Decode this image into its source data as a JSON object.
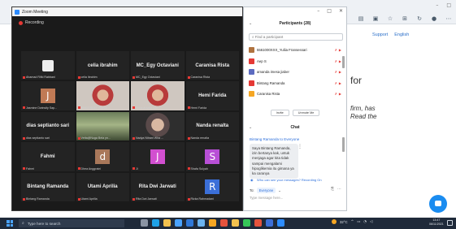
{
  "zoom": {
    "title": "Zoom Meeting",
    "recording": "Recording",
    "tiles": [
      {
        "name": "",
        "label": "Ahamad Rifki Rabbani",
        "avatar": "",
        "logo": true
      },
      {
        "name": "celia ibrahim",
        "label": "celia ibrahim",
        "avatar": ""
      },
      {
        "name": "MC_Egy Octaviani",
        "label": "MC_Egy Octaviani",
        "avatar": ""
      },
      {
        "name": "Caranisa Rista",
        "label": "Caranisa Rista",
        "avatar": ""
      },
      {
        "name": "",
        "label": "Jasmine Dwinsity Sap...",
        "avatar": "J",
        "avatar_color": "#c07a55"
      },
      {
        "name": "",
        "label": "5566293087_Salma ...",
        "video": "person"
      },
      {
        "name": "",
        "label": "Suna Amalia sari",
        "video": "person",
        "active": true
      },
      {
        "name": "Hemi Farida",
        "label": "Hemi Farida",
        "avatar": ""
      },
      {
        "name": "dias septianto sari",
        "label": "dias septianto sari",
        "avatar": ""
      },
      {
        "name": "",
        "label": "Vetta@Nuga Bela yn...",
        "video": "plant"
      },
      {
        "name": "",
        "label": "Nadya Nitrani Wira ...",
        "video": "person2"
      },
      {
        "name": "Nanda renalta",
        "label": "Nanda renalta",
        "avatar": ""
      },
      {
        "name": "Fahmi",
        "label": "Fahmi",
        "avatar": ""
      },
      {
        "name": "",
        "label": "Dhea Anggraini",
        "avatar": "d",
        "avatar_color": "#a9785a"
      },
      {
        "name": "",
        "label": "Ji",
        "avatar": "J",
        "avatar_color": "#d24fd0"
      },
      {
        "name": "",
        "label": "Shafa Sulyah",
        "avatar": "S",
        "avatar_color": "#b84fd6"
      },
      {
        "name": "Bintang Ramanda",
        "label": "Bintang Ramanda",
        "avatar": ""
      },
      {
        "name": "Utami Aprilia",
        "label": "Utami Aprilia",
        "avatar": ""
      },
      {
        "name": "Rita Dwi Jarwati",
        "label": "Rita Dwi Jarwati",
        "avatar": ""
      },
      {
        "name": "",
        "label": "Rizka Rahmadani",
        "avatar": "R",
        "avatar_color": "#3b6fd8"
      }
    ]
  },
  "participants": {
    "title": "Participants (28)",
    "search_placeholder": "Find a participant",
    "list": [
      {
        "name": "5561000XXX_Yuliia Fransessari",
        "color": "#b0733f"
      },
      {
        "name": "Aep S",
        "color": "#e53935"
      },
      {
        "name": "amanda imesa jiaber",
        "color": "#5c6bc0"
      },
      {
        "name": "Bintang Ramanda",
        "color": "#e53935"
      },
      {
        "name": "Caranisa Rista",
        "color": "#f5a623"
      }
    ],
    "invite_label": "Invite",
    "unmute_label": "Unmute Me"
  },
  "chat": {
    "title": "Chat",
    "sender": "Bintang Ramanda to Everyone",
    "message": "Saya Bintang Ramanda, izin bertanya kak, untuk menjaga agar kita tidak sampai mengalami hipoglikemia itu gimana ya ka caranya",
    "notice": "Who can see your messages? Recording On",
    "to_label": "To:",
    "to_value": "Everyone",
    "input_placeholder": "Type message here..."
  },
  "browser": {
    "support": "Support",
    "language": "English",
    "heading": "for",
    "body_line1": "firm, has",
    "body_line2": "Read the"
  },
  "taskbar": {
    "search_placeholder": "Type here to search",
    "weather": "32°C",
    "time": "13:47",
    "date": "06/11/2021"
  },
  "colors": {
    "zoom_bg": "#1a1a1a",
    "tile_bg": "#232323",
    "accent": "#2d8cff",
    "muted": "#e53935"
  }
}
